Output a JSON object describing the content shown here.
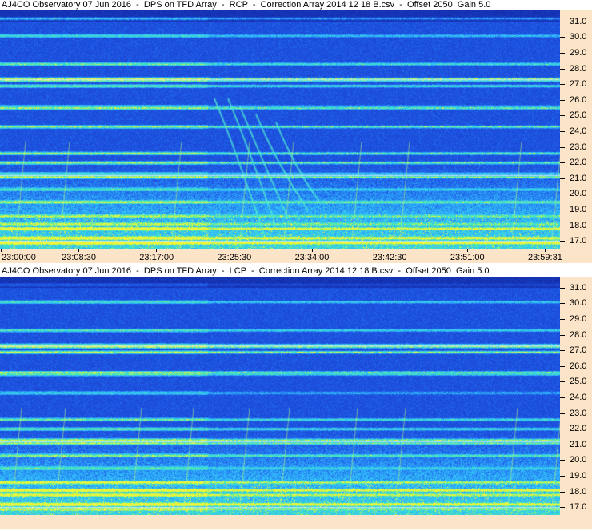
{
  "chart_data": [
    {
      "type": "heatmap",
      "title": "AJ4CO Observatory 07 Jun 2016  -  DPS on TFD Array  -  RCP  -  Correction Array 2014 12 18 B.csv  -  Offset 2050  Gain 5.0",
      "xlabel": "",
      "ylabel": "",
      "x_ticks": [
        "23:00:00",
        "23:08:30",
        "23:17:00",
        "23:25:30",
        "23:34:00",
        "23:42:30",
        "23:51:00",
        "23:59:31"
      ],
      "y_ticks": [
        "31.0",
        "30.0",
        "29.0",
        "28.0",
        "27.0",
        "26.0",
        "25.0",
        "24.0",
        "23.0",
        "22.0",
        "21.0",
        "20.0",
        "19.0",
        "18.0",
        "17.0"
      ],
      "ylim": [
        16.5,
        31.7
      ],
      "xlim": [
        "23:00:00",
        "23:59:31"
      ],
      "colors": {
        "background": "#1f4ce0",
        "low": "#1a3fbf",
        "mid": "#2fa6ff",
        "high": "#3de8c0",
        "peak": "#e8f040",
        "axis_bg": "#fce4c8"
      }
    },
    {
      "type": "heatmap",
      "title": "AJ4CO Observatory 07 Jun 2016  -  DPS on TFD Array  -  LCP  -  Correction Array 2014 12 18 B.csv  -  Offset 2050  Gain 5.0",
      "xlabel": "",
      "ylabel": "",
      "x_ticks": [],
      "y_ticks": [
        "31.0",
        "30.0",
        "29.0",
        "28.0",
        "27.0",
        "26.0",
        "25.0",
        "24.0",
        "23.0",
        "22.0",
        "21.0",
        "20.0",
        "19.0",
        "18.0",
        "17.0"
      ],
      "ylim": [
        16.5,
        31.7
      ],
      "colors": {
        "background": "#1f4ce0",
        "low": "#1a3fbf",
        "mid": "#2fa6ff",
        "high": "#3de8c0",
        "peak": "#e8f040",
        "axis_bg": "#fce4c8"
      }
    }
  ]
}
